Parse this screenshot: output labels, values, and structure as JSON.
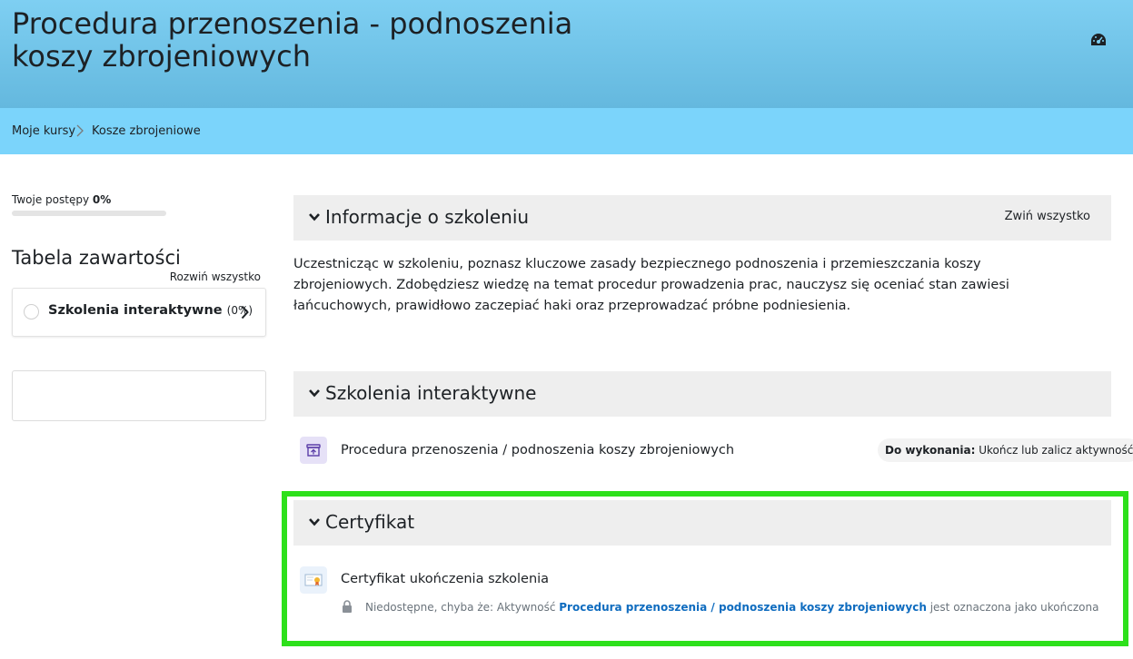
{
  "header": {
    "title": "Procedura przenoszenia - podnoszenia koszy zbrojeniowych",
    "dashboard_icon": "dashboard-icon"
  },
  "breadcrumb": {
    "items": [
      "Moje kursy",
      "Kosze zbrojeniowe"
    ],
    "separator_icon": "chevron-right-icon"
  },
  "sidebar": {
    "progress_label": "Twoje postępy",
    "progress_value": "0%",
    "progress_fraction": 0,
    "toc_title": "Tabela zawartości",
    "expand_all": "Rozwiń wszystko",
    "toc_items": [
      {
        "label": "Szkolenia interaktywne",
        "percent": "(0%)"
      }
    ]
  },
  "main": {
    "collapse_all": "Zwiń wszystko",
    "sections": [
      {
        "title": "Informacje o szkoleniu",
        "summary": "Uczestnicząc w szkoleniu, poznasz kluczowe zasady bezpiecznego podnoszenia i przemieszczania koszy zbrojeniowych. Zdobędziesz wiedzę na temat procedur prowadzenia prac, nauczysz się oceniać stan zawiesi łańcuchowych, prawidłowo zaczepiać haki oraz przeprowadzać próbne podniesienia."
      },
      {
        "title": "Szkolenia interaktywne",
        "activity": {
          "name": "Procedura przenoszenia / podnoszenia koszy zbrojeniowych",
          "icon": "scorm-package-icon",
          "todo_label": "Do wykonania:",
          "todo_value": "Ukończ lub zalicz aktywność"
        }
      },
      {
        "title": "Certyfikat",
        "activity": {
          "name": "Certyfikat ukończenia szkolenia",
          "icon": "certificate-icon",
          "restriction_prefix": "Niedostępne, chyba że: Aktywność",
          "restriction_link": "Procedura przenoszenia / podnoszenia koszy zbrojeniowych",
          "restriction_suffix": "jest oznaczona jako ukończona",
          "lock_icon": "lock-icon"
        }
      }
    ]
  },
  "colors": {
    "header_bg": "#6fc3e8",
    "breadcrumb_bg": "#7bd4fb",
    "section_bg": "#eeeeee",
    "highlight": "#2de01b",
    "link": "#0f6cbf"
  }
}
